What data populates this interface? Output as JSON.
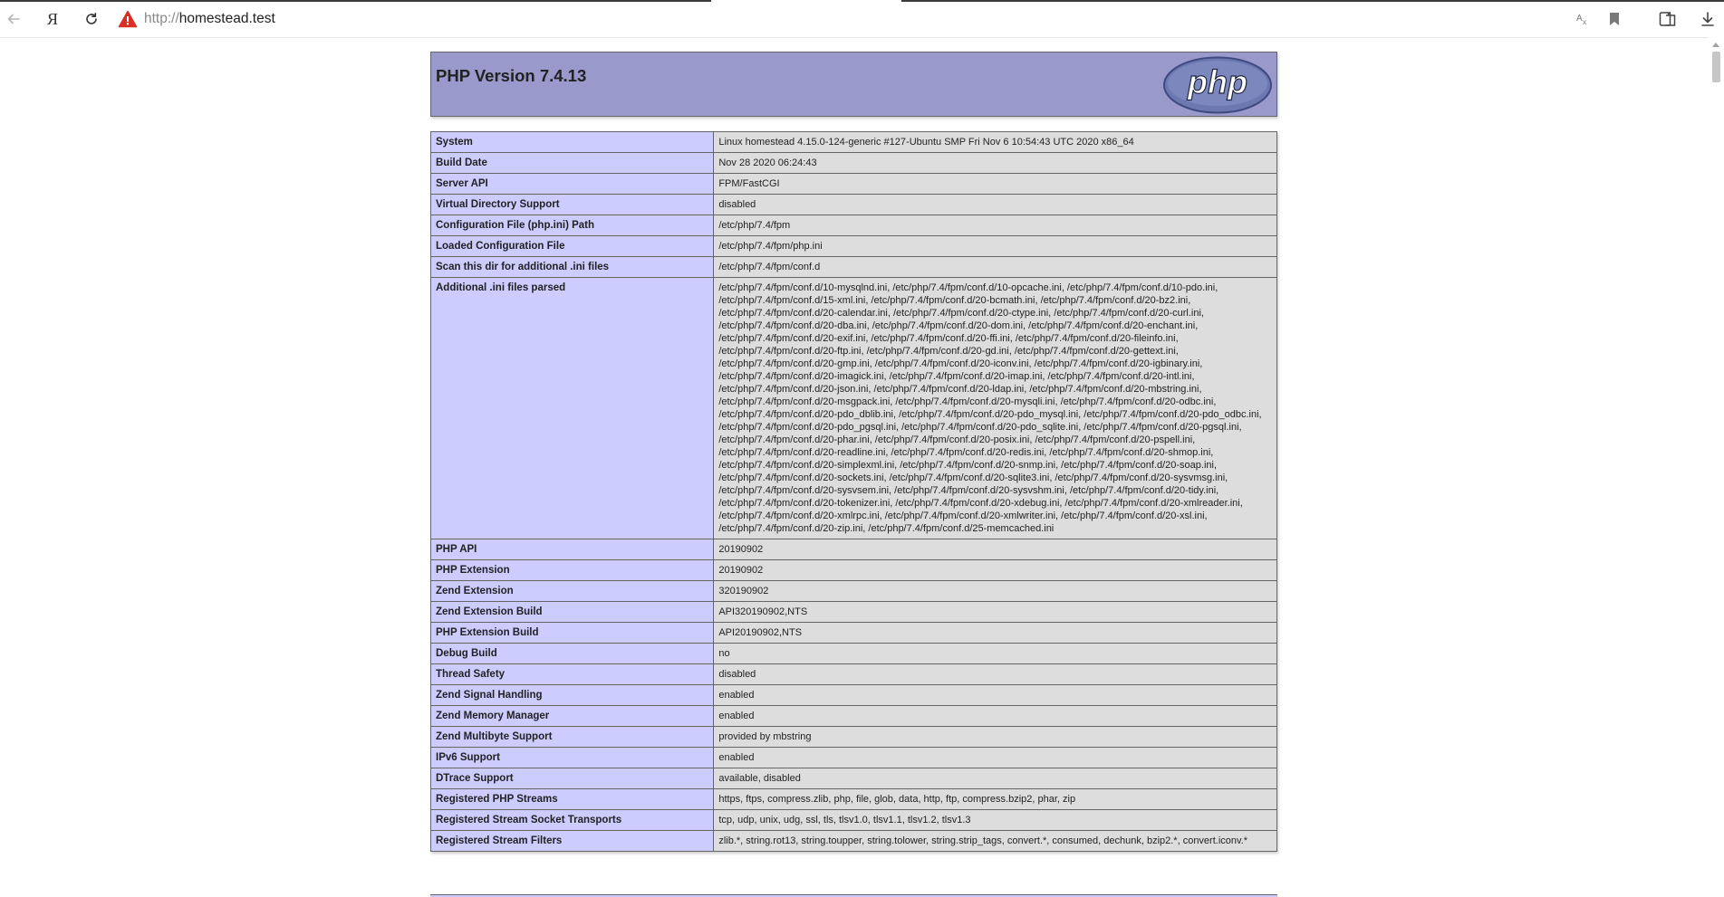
{
  "browser": {
    "url_protocol": "http://",
    "url_host": "homestead.test",
    "yandex_glyph": "Я",
    "icons": {
      "back": "arrow-left-icon",
      "yandex": "yandex-icon",
      "reload": "reload-icon",
      "warning": "warning-triangle-icon",
      "translate": "translate-icon",
      "bookmark": "bookmark-icon",
      "collections": "collections-icon",
      "download": "download-icon"
    }
  },
  "page": {
    "title": "PHP Version 7.4.13",
    "logo_text": "php",
    "colors": {
      "header": "#9999cc",
      "label_cell": "#ccccff",
      "value_cell": "#dddddd",
      "border": "#666666"
    },
    "rows": [
      {
        "label": "System",
        "value": "Linux homestead 4.15.0-124-generic #127-Ubuntu SMP Fri Nov 6 10:54:43 UTC 2020 x86_64"
      },
      {
        "label": "Build Date",
        "value": "Nov 28 2020 06:24:43"
      },
      {
        "label": "Server API",
        "value": "FPM/FastCGI"
      },
      {
        "label": "Virtual Directory Support",
        "value": "disabled"
      },
      {
        "label": "Configuration File (php.ini) Path",
        "value": "/etc/php/7.4/fpm"
      },
      {
        "label": "Loaded Configuration File",
        "value": "/etc/php/7.4/fpm/php.ini"
      },
      {
        "label": "Scan this dir for additional .ini files",
        "value": "/etc/php/7.4/fpm/conf.d"
      },
      {
        "label": "Additional .ini files parsed",
        "value": "/etc/php/7.4/fpm/conf.d/10-mysqlnd.ini, /etc/php/7.4/fpm/conf.d/10-opcache.ini, /etc/php/7.4/fpm/conf.d/10-pdo.ini, /etc/php/7.4/fpm/conf.d/15-xml.ini, /etc/php/7.4/fpm/conf.d/20-bcmath.ini, /etc/php/7.4/fpm/conf.d/20-bz2.ini, /etc/php/7.4/fpm/conf.d/20-calendar.ini, /etc/php/7.4/fpm/conf.d/20-ctype.ini, /etc/php/7.4/fpm/conf.d/20-curl.ini, /etc/php/7.4/fpm/conf.d/20-dba.ini, /etc/php/7.4/fpm/conf.d/20-dom.ini, /etc/php/7.4/fpm/conf.d/20-enchant.ini, /etc/php/7.4/fpm/conf.d/20-exif.ini, /etc/php/7.4/fpm/conf.d/20-ffi.ini, /etc/php/7.4/fpm/conf.d/20-fileinfo.ini, /etc/php/7.4/fpm/conf.d/20-ftp.ini, /etc/php/7.4/fpm/conf.d/20-gd.ini, /etc/php/7.4/fpm/conf.d/20-gettext.ini, /etc/php/7.4/fpm/conf.d/20-gmp.ini, /etc/php/7.4/fpm/conf.d/20-iconv.ini, /etc/php/7.4/fpm/conf.d/20-igbinary.ini, /etc/php/7.4/fpm/conf.d/20-imagick.ini, /etc/php/7.4/fpm/conf.d/20-imap.ini, /etc/php/7.4/fpm/conf.d/20-intl.ini, /etc/php/7.4/fpm/conf.d/20-json.ini, /etc/php/7.4/fpm/conf.d/20-ldap.ini, /etc/php/7.4/fpm/conf.d/20-mbstring.ini, /etc/php/7.4/fpm/conf.d/20-msgpack.ini, /etc/php/7.4/fpm/conf.d/20-mysqli.ini, /etc/php/7.4/fpm/conf.d/20-odbc.ini, /etc/php/7.4/fpm/conf.d/20-pdo_dblib.ini, /etc/php/7.4/fpm/conf.d/20-pdo_mysql.ini, /etc/php/7.4/fpm/conf.d/20-pdo_odbc.ini, /etc/php/7.4/fpm/conf.d/20-pdo_pgsql.ini, /etc/php/7.4/fpm/conf.d/20-pdo_sqlite.ini, /etc/php/7.4/fpm/conf.d/20-pgsql.ini, /etc/php/7.4/fpm/conf.d/20-phar.ini, /etc/php/7.4/fpm/conf.d/20-posix.ini, /etc/php/7.4/fpm/conf.d/20-pspell.ini, /etc/php/7.4/fpm/conf.d/20-readline.ini, /etc/php/7.4/fpm/conf.d/20-redis.ini, /etc/php/7.4/fpm/conf.d/20-shmop.ini, /etc/php/7.4/fpm/conf.d/20-simplexml.ini, /etc/php/7.4/fpm/conf.d/20-snmp.ini, /etc/php/7.4/fpm/conf.d/20-soap.ini, /etc/php/7.4/fpm/conf.d/20-sockets.ini, /etc/php/7.4/fpm/conf.d/20-sqlite3.ini, /etc/php/7.4/fpm/conf.d/20-sysvmsg.ini, /etc/php/7.4/fpm/conf.d/20-sysvsem.ini, /etc/php/7.4/fpm/conf.d/20-sysvshm.ini, /etc/php/7.4/fpm/conf.d/20-tidy.ini, /etc/php/7.4/fpm/conf.d/20-tokenizer.ini, /etc/php/7.4/fpm/conf.d/20-xdebug.ini, /etc/php/7.4/fpm/conf.d/20-xmlreader.ini, /etc/php/7.4/fpm/conf.d/20-xmlrpc.ini, /etc/php/7.4/fpm/conf.d/20-xmlwriter.ini, /etc/php/7.4/fpm/conf.d/20-xsl.ini, /etc/php/7.4/fpm/conf.d/20-zip.ini, /etc/php/7.4/fpm/conf.d/25-memcached.ini"
      },
      {
        "label": "PHP API",
        "value": "20190902"
      },
      {
        "label": "PHP Extension",
        "value": "20190902"
      },
      {
        "label": "Zend Extension",
        "value": "320190902"
      },
      {
        "label": "Zend Extension Build",
        "value": "API320190902,NTS"
      },
      {
        "label": "PHP Extension Build",
        "value": "API20190902,NTS"
      },
      {
        "label": "Debug Build",
        "value": "no"
      },
      {
        "label": "Thread Safety",
        "value": "disabled"
      },
      {
        "label": "Zend Signal Handling",
        "value": "enabled"
      },
      {
        "label": "Zend Memory Manager",
        "value": "enabled"
      },
      {
        "label": "Zend Multibyte Support",
        "value": "provided by mbstring"
      },
      {
        "label": "IPv6 Support",
        "value": "enabled"
      },
      {
        "label": "DTrace Support",
        "value": "available, disabled"
      },
      {
        "label": "Registered PHP Streams",
        "value": "https, ftps, compress.zlib, php, file, glob, data, http, ftp, compress.bzip2, phar, zip"
      },
      {
        "label": "Registered Stream Socket Transports",
        "value": "tcp, udp, unix, udg, ssl, tls, tlsv1.0, tlsv1.1, tlsv1.2, tlsv1.3"
      },
      {
        "label": "Registered Stream Filters",
        "value": "zlib.*, string.rot13, string.toupper, string.tolower, string.strip_tags, convert.*, consumed, dechunk, bzip2.*, convert.iconv.*"
      }
    ]
  }
}
